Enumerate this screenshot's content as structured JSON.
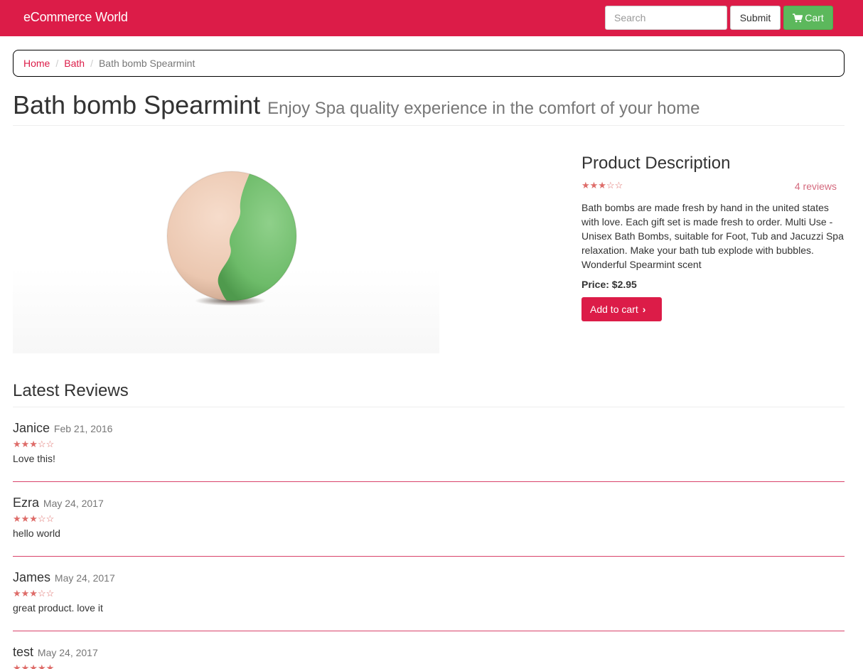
{
  "navbar": {
    "brand": "eCommerce World",
    "search_placeholder": "Search",
    "submit_label": "Submit",
    "cart_label": "Cart",
    "accent": "#dc1c48",
    "cart_color": "#5cb85c"
  },
  "breadcrumb": {
    "items": [
      "Home",
      "Bath",
      "Bath bomb Spearmint"
    ]
  },
  "product": {
    "title": "Bath bomb Spearmint",
    "subtitle": "Enjoy Spa quality experience in the comfort of your home",
    "image_icon": "bath-bomb-image",
    "description_heading": "Product Description",
    "rating": {
      "value": 3,
      "max": 5,
      "stars": "★★★☆☆"
    },
    "reviews_count_label": "4 reviews",
    "description": "Bath bombs are made fresh by hand in the united states with love. Each gift set is made fresh to order. Multi Use - Unisex Bath Bombs, suitable for Foot, Tub and Jacuzzi Spa relaxation. Make your bath tub explode with bubbles. Wonderful Spearmint scent",
    "price_label": "Price: $2.95",
    "add_to_cart_label": "Add to cart"
  },
  "reviews": {
    "heading": "Latest Reviews",
    "items": [
      {
        "name": "Janice",
        "date": "Feb 21, 2016",
        "rating": 3,
        "stars": "★★★☆☆",
        "text": "Love this!"
      },
      {
        "name": "Ezra",
        "date": "May 24, 2017",
        "rating": 3,
        "stars": "★★★☆☆",
        "text": "hello world"
      },
      {
        "name": "James",
        "date": "May 24, 2017",
        "rating": 3,
        "stars": "★★★☆☆",
        "text": "great product. love it"
      },
      {
        "name": "test",
        "date": "May 24, 2017",
        "rating": 5,
        "stars": "★★★★★",
        "text": ""
      }
    ]
  }
}
